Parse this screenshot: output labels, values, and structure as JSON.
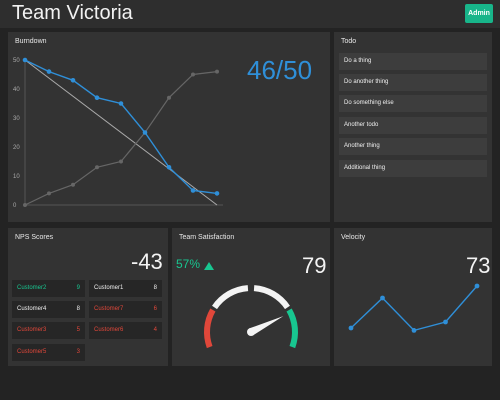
{
  "header": {
    "title": "Team Victoria",
    "admin_label": "Admin"
  },
  "burndown": {
    "title": "Burndown",
    "score": "46/50",
    "y_ticks": [
      "50",
      "40",
      "30",
      "20",
      "10",
      "0"
    ],
    "colors": {
      "actual": "#2f8fd8",
      "burnup": "#666666",
      "ideal": "#aaaaaa"
    },
    "actual": [
      50,
      46,
      43,
      37,
      35,
      25,
      13,
      5,
      4
    ],
    "burnup": [
      0,
      4,
      7,
      13,
      15,
      25,
      37,
      45,
      46
    ]
  },
  "todo": {
    "title": "Todo",
    "items": [
      "Do a thing",
      "Do another thing",
      "Do something else",
      "Another todo",
      "Another thing",
      "Additional thing"
    ]
  },
  "nps": {
    "title": "NPS Scores",
    "score": "-43",
    "colors": {
      "positive": "#18c690",
      "neutral": "#f0f0f0",
      "negative": "#e0473a"
    },
    "customers": [
      {
        "name": "Customer2",
        "value": "9",
        "status": "positive"
      },
      {
        "name": "Customer1",
        "value": "8",
        "status": "neutral"
      },
      {
        "name": "Customer4",
        "value": "8",
        "status": "neutral"
      },
      {
        "name": "Customer7",
        "value": "6",
        "status": "negative"
      },
      {
        "name": "Customer3",
        "value": "5",
        "status": "negative"
      },
      {
        "name": "Customer6",
        "value": "4",
        "status": "negative"
      },
      {
        "name": "Customer5",
        "value": "3",
        "status": "negative"
      }
    ]
  },
  "satisfaction": {
    "title": "Team Satisfaction",
    "percent": "57%",
    "trend_icon": "triangle-up-icon",
    "score": "79",
    "gauge_level": 0.79,
    "colors": {
      "low": "#e0473a",
      "mid": "#f4f4f4",
      "high": "#18c690"
    }
  },
  "velocity": {
    "title": "Velocity",
    "score": "73",
    "color": "#2f8fd8",
    "values": [
      30,
      55,
      28,
      35,
      65
    ]
  }
}
